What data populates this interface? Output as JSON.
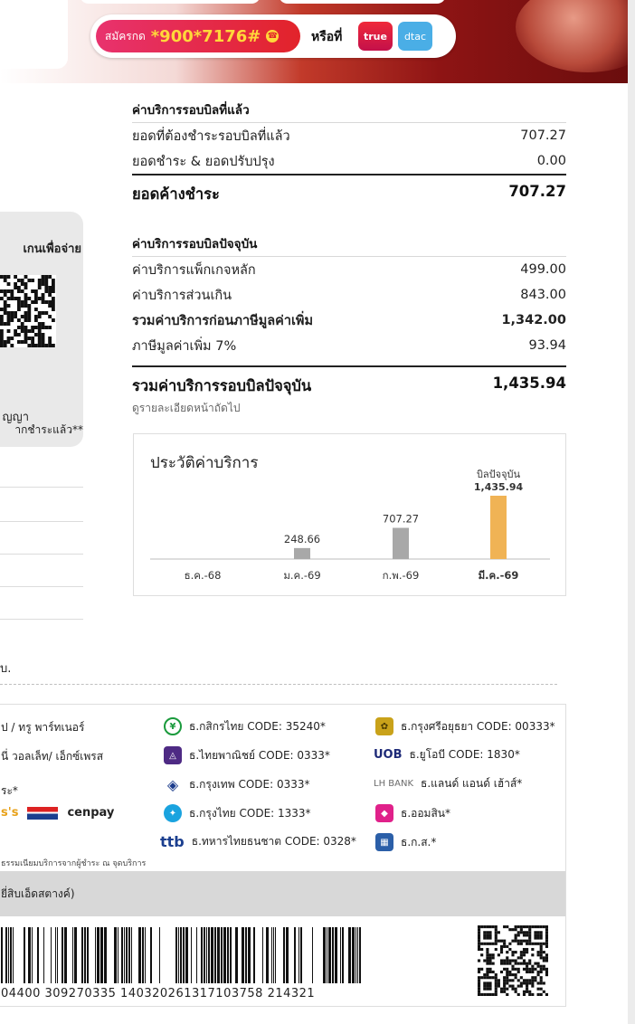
{
  "promo": {
    "prefix": "สมัครกด",
    "code": "*900*7176#",
    "or": "หรือที่",
    "brand1": "true",
    "brand2": "dtac"
  },
  "left_card": {
    "title": "เกนเพื่อจ่าย",
    "note1": "ญญา",
    "note2": "ากชำระแล้ว**"
  },
  "left_fragment": "บ.",
  "previous": {
    "title": "ค่าบริการรอบบิลที่แล้ว",
    "rows": [
      {
        "label": "ยอดที่ต้องชำระรอบบิลที่แล้ว",
        "value": "707.27"
      },
      {
        "label": "ยอดชำระ & ยอดปรับปรุง",
        "value": "0.00"
      }
    ],
    "total_label": "ยอดค้างชำระ",
    "total_value": "707.27"
  },
  "current": {
    "title": "ค่าบริการรอบบิลปัจจุบัน",
    "rows": [
      {
        "label": "ค่าบริการแพ็กเกจหลัก",
        "value": "499.00"
      },
      {
        "label": "ค่าบริการส่วนเกิน",
        "value": "843.00"
      },
      {
        "label": "รวมค่าบริการก่อนภาษีมูลค่าเพิ่ม",
        "value": "1,342.00"
      },
      {
        "label": "ภาษีมูลค่าเพิ่ม 7%",
        "value": "93.94"
      }
    ],
    "total_label": "รวมค่าบริการรอบบิลปัจจุบัน",
    "total_value": "1,435.94",
    "note": "ดูรายละเอียดหน้าถัดไป"
  },
  "chart_data": {
    "type": "bar",
    "title": "ประวัติค่าบริการ",
    "categories": [
      "ธ.ค.-68",
      "ม.ค.-69",
      "ก.พ.-69",
      "มี.ค.-69"
    ],
    "values": [
      0,
      248.66,
      707.27,
      1435.94
    ],
    "labels": [
      "",
      "248.66",
      "707.27",
      "1,435.94"
    ],
    "current_label": "บิลปัจจุบัน",
    "highlight_index": 3,
    "colors": {
      "normal": "#a8a8a8",
      "highlight": "#f0b355"
    },
    "ylim": [
      0,
      1435.94
    ]
  },
  "banks": {
    "left": [
      "ป / ทรู พาร์ทเนอร์",
      "นี่ วอลเล็ท/ เอ็กซ์เพรส",
      "ระ*",
      "cenpay"
    ],
    "col1": [
      {
        "name": "ธ.กสิกรไทย CODE: 35240*",
        "icon": "kbank-icon",
        "color": "#1a9a3c"
      },
      {
        "name": "ธ.ไทยพาณิชย์ CODE: 0333*",
        "icon": "scb-icon",
        "color": "#4e2a84"
      },
      {
        "name": "ธ.กรุงเทพ CODE: 0333*",
        "icon": "bbl-icon",
        "color": "#1c3c8c"
      },
      {
        "name": "ธ.กรุงไทย CODE: 1333*",
        "icon": "ktb-icon",
        "color": "#1aa3df"
      },
      {
        "name": "ธ.ทหารไทยธนชาต CODE: 0328*",
        "icon": "ttb-icon",
        "color": "#1b3f8f"
      }
    ],
    "col2": [
      {
        "name": "ธ.กรุงศรีอยุธยา CODE: 00333*",
        "icon": "krungsri-icon",
        "color": "#c9a21a"
      },
      {
        "name": "ธ.ยูโอบี CODE: 1830*",
        "icon": "uob-icon",
        "color": "#1e2a78"
      },
      {
        "name": "ธ.แลนด์ แอนด์ เฮ้าส์*",
        "icon": "lhbank-icon",
        "color": "#6b6b6b"
      },
      {
        "name": "ธ.ออมสิน*",
        "icon": "gsb-icon",
        "color": "#e0218a"
      },
      {
        "name": "ธ.ก.ส.*",
        "icon": "baac-icon",
        "color": "#2b5fa8"
      }
    ],
    "uob_text": "UOB",
    "lh_text": "LH BANK",
    "ttb_text": "ttb",
    "fine_print": "ธรรมเนียมบริการจากผู้ชำระ ณ จุดบริการ",
    "band_text": "ยี่สิบเอ็ดสตางค์)",
    "barcode_number": "04400 309270335 140320261317103758 214321"
  }
}
